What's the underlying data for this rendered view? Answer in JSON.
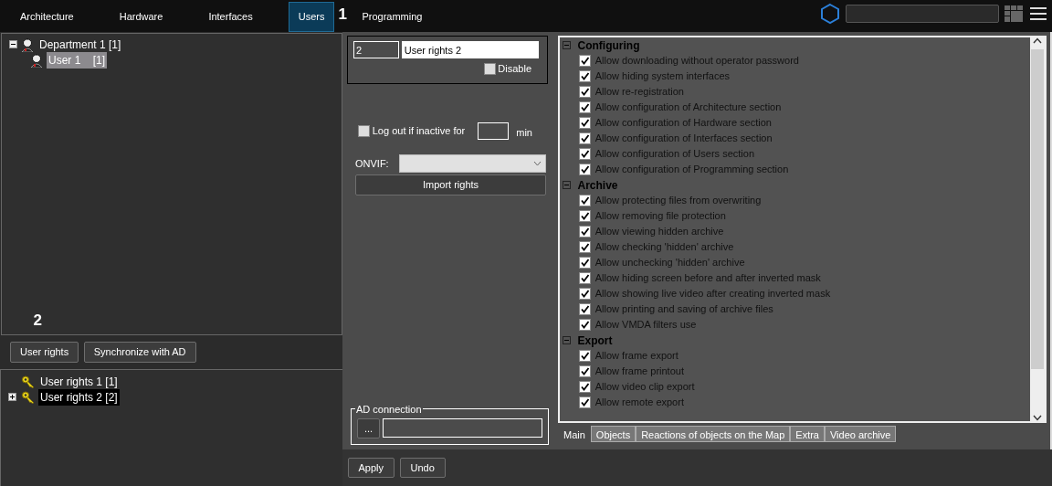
{
  "nav": {
    "tabs": [
      {
        "label": "Architecture",
        "selected": false
      },
      {
        "label": "Hardware",
        "selected": false
      },
      {
        "label": "Interfaces",
        "selected": false
      },
      {
        "label": "Users",
        "selected": true
      },
      {
        "label": "Programming",
        "selected": false
      }
    ],
    "marker": "1"
  },
  "dept_tree": [
    {
      "label": "Department 1 [1]",
      "selected": false,
      "expanded": true,
      "children": [
        {
          "label": "User 1    [1]",
          "selected": true
        }
      ]
    }
  ],
  "marker_2": "2",
  "left_buttons": [
    "User rights",
    "Synchronize with AD"
  ],
  "rights_tree": [
    {
      "label": "User rights 1 [1]",
      "selected": false,
      "expandable": false
    },
    {
      "label": "User rights 2 [2]",
      "selected": true,
      "expandable": true
    }
  ],
  "form": {
    "id": "2",
    "name": "User rights 2",
    "disable": {
      "label": "Disable",
      "checked": false
    },
    "logout": {
      "label": "Log out if inactive for",
      "checked": false,
      "unit": "min"
    },
    "onvif_label": "ONVIF:",
    "import_button": "Import rights",
    "ad": {
      "legend": "AD connection",
      "browse": "..."
    }
  },
  "permissions": [
    {
      "title": "Configuring",
      "expanded": true,
      "items": [
        {
          "label": "Allow downloading without operator password",
          "checked": true
        },
        {
          "label": "Allow hiding system interfaces",
          "checked": true
        },
        {
          "label": "Allow re-registration",
          "checked": true
        },
        {
          "label": "Allow configuration of Architecture section",
          "checked": true
        },
        {
          "label": "Allow configuration of Hardware section",
          "checked": true
        },
        {
          "label": "Allow configuration of Interfaces section",
          "checked": true
        },
        {
          "label": "Allow configuration of Users section",
          "checked": true
        },
        {
          "label": "Allow configuration of Programming section",
          "checked": true
        }
      ]
    },
    {
      "title": "Archive",
      "expanded": true,
      "items": [
        {
          "label": "Allow protecting files from overwriting",
          "checked": true
        },
        {
          "label": "Allow removing file protection",
          "checked": true
        },
        {
          "label": "Allow viewing hidden archive",
          "checked": true
        },
        {
          "label": "Allow checking 'hidden' archive",
          "checked": true
        },
        {
          "label": "Allow unchecking 'hidden' archive",
          "checked": true
        },
        {
          "label": "Allow hiding screen before and after inverted mask",
          "checked": true
        },
        {
          "label": "Allow showing live video after creating inverted mask",
          "checked": true
        },
        {
          "label": "Allow printing and saving of archive files",
          "checked": true
        },
        {
          "label": "Allow VMDA filters use",
          "checked": true
        }
      ]
    },
    {
      "title": "Export",
      "expanded": true,
      "items": [
        {
          "label": "Allow frame export",
          "checked": true
        },
        {
          "label": "Allow frame printout",
          "checked": true
        },
        {
          "label": "Allow video clip export",
          "checked": true
        },
        {
          "label": "Allow remote export",
          "checked": true
        }
      ]
    }
  ],
  "bottom_tabs": [
    {
      "label": "Main",
      "selected": true
    },
    {
      "label": "Objects",
      "selected": false
    },
    {
      "label": "Reactions of objects on the Map",
      "selected": false
    },
    {
      "label": "Extra",
      "selected": false
    },
    {
      "label": "Video archive",
      "selected": false
    }
  ],
  "actions": [
    "Apply",
    "Undo"
  ]
}
